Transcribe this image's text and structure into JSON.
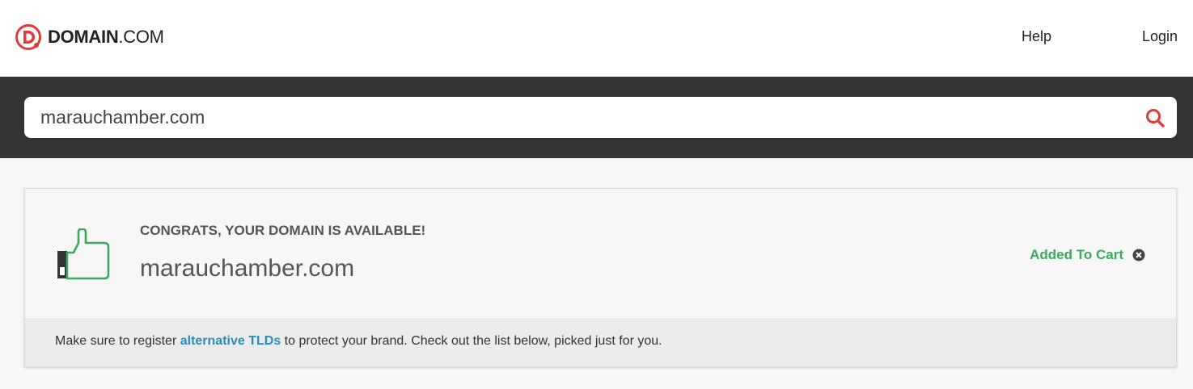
{
  "header": {
    "logo_bold": "DOMAIN",
    "logo_suffix": ".COM",
    "nav": {
      "help_label": "Help",
      "login_label": "Login"
    }
  },
  "search": {
    "value": "marauchamber.com",
    "icon": "search-icon"
  },
  "result": {
    "heading": "CONGRATS, YOUR DOMAIN IS AVAILABLE!",
    "domain": "marauchamber.com",
    "status_label": "Added To Cart",
    "status_icon": "close-circle-icon",
    "thumb_icon": "thumbs-up-icon"
  },
  "footer": {
    "text_before": "Make sure to register ",
    "link_text": "alternative TLDs",
    "text_after": " to protect your brand. Check out the list below, picked just for you."
  },
  "colors": {
    "brand_red": "#e03a3a",
    "success_green": "#3aaa5c",
    "link_blue": "#2a8db8",
    "search_band": "#333333"
  }
}
